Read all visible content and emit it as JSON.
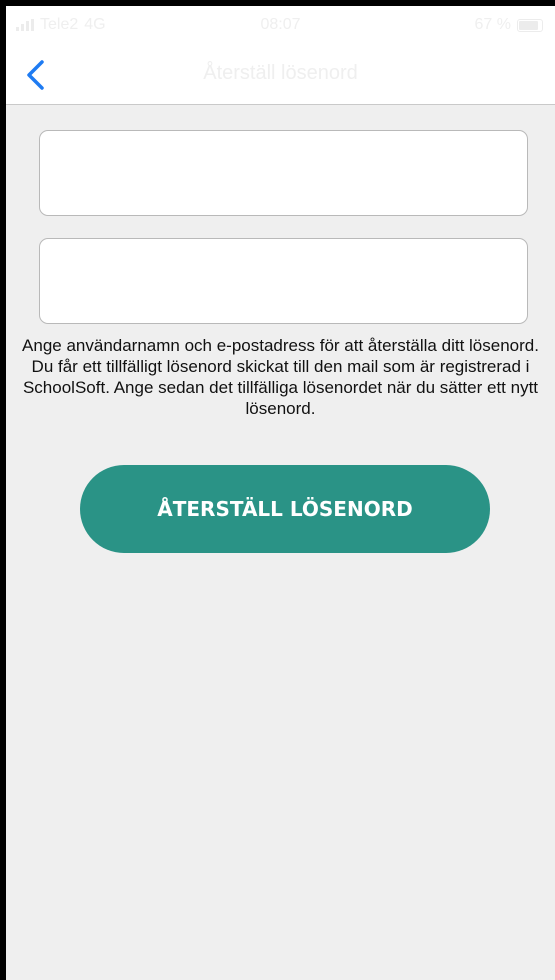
{
  "status_bar": {
    "carrier": "Tele2",
    "network": "4G",
    "time": "08:07",
    "battery": "67 %",
    "icons": [
      "signal-icon",
      "battery-icon"
    ]
  },
  "nav": {
    "title": "Återställ lösenord",
    "back_icon": "chevron-left-icon"
  },
  "form": {
    "username_value": "",
    "email_value": "",
    "help_text": "Ange användarnamn och e-postadress för att återställa ditt lösenord. Du får ett tillfälligt lösenord skickat till den mail som är registrerad i SchoolSoft. Ange sedan det tillfälliga lösenordet när du sätter ett nytt lösenord.",
    "submit_label": "ÅTERSTÄLL LÖSENORD"
  },
  "colors": {
    "accent": "#2a9386",
    "back_chevron": "#1e7bf2",
    "background": "#efefef"
  }
}
